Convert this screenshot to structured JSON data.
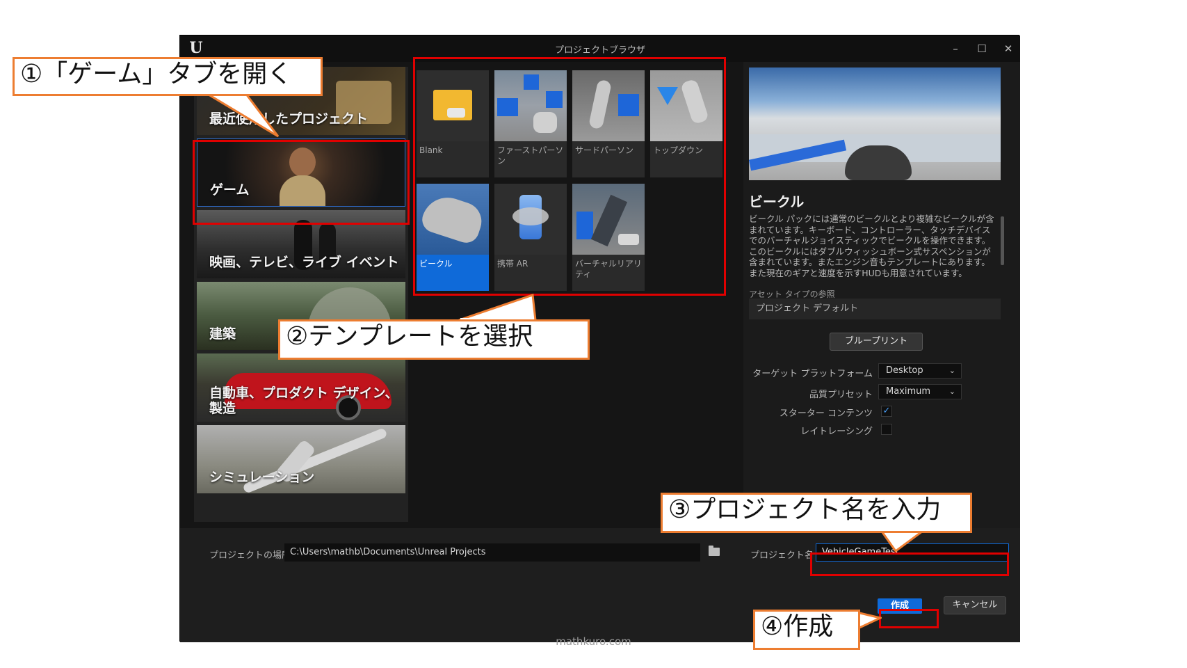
{
  "window": {
    "title": "プロジェクトブラウザ",
    "logo": "ue-logo",
    "controls": {
      "minimize": "–",
      "maximize": "☐",
      "close": "✕"
    }
  },
  "categories": [
    {
      "label": "最近使用したプロジェクト",
      "icon": "clock-icon"
    },
    {
      "label": "ゲーム",
      "selected": true
    },
    {
      "label": "映画、テレビ、ライブ イベント"
    },
    {
      "label": "建築"
    },
    {
      "label": "自動車、プロダクト デザイン、製造"
    },
    {
      "label": "シミュレーション"
    }
  ],
  "templates": [
    {
      "label": "Blank"
    },
    {
      "label": "ファーストパーソン"
    },
    {
      "label": "サードパーソン"
    },
    {
      "label": "トップダウン"
    },
    {
      "label": "ビークル",
      "selected": true
    },
    {
      "label": "携帯 AR"
    },
    {
      "label": "バーチャルリアリティ"
    }
  ],
  "details": {
    "title": "ビークル",
    "description": "ビークル パックには通常のビークルとより複雑なビークルが含まれています。キーボード、コントローラー、タッチデバイスでのバーチャルジョイスティックでビークルを操作できます。このビークルにはダブルウィッシュボーン式サスペンションが含まれています。またエンジン音もテンプレートにあります。また現在のギアと速度を示すHUDも用意されています。",
    "asset_type_heading": "アセット タイプの参照",
    "asset_type_value": "プロジェクト デフォルト",
    "blueprint_button": "ブループリント",
    "target_platform_label": "ターゲット プラットフォーム",
    "target_platform_value": "Desktop",
    "quality_preset_label": "品質プリセット",
    "quality_preset_value": "Maximum",
    "starter_content_label": "スターター コンテンツ",
    "starter_content_checked": true,
    "raytracing_label": "レイトレーシング",
    "raytracing_checked": false
  },
  "bottom": {
    "location_label": "プロジェクトの場所",
    "location_value": "C:\\Users\\mathb\\Documents\\Unreal Projects",
    "name_label": "プロジェクト名",
    "name_value": "VehicleGameTest",
    "create_button": "作成",
    "cancel_button": "キャンセル"
  },
  "annotations": {
    "step1": "①「ゲーム」タブを開く",
    "step2": "②テンプレートを選択",
    "step3": "③プロジェクト名を入力",
    "step4": "④作成",
    "box_color": "#e00000",
    "callout_border": "#ed7d31"
  },
  "footer": "mathkuro.com",
  "colors": {
    "accent": "#0f6ad9",
    "window_bg": "#151515",
    "panel_bg": "#1b1b1b"
  }
}
